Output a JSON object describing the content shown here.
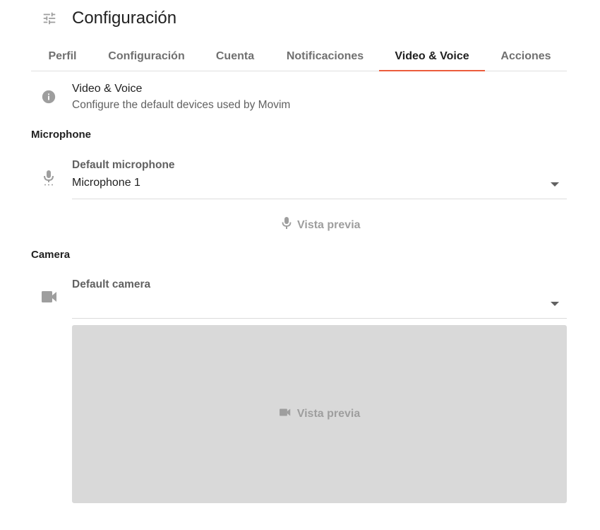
{
  "header": {
    "title": "Configuración",
    "icon": "tune-icon"
  },
  "tabs": [
    {
      "label": "Perfil",
      "active": false
    },
    {
      "label": "Configuración",
      "active": false
    },
    {
      "label": "Cuenta",
      "active": false
    },
    {
      "label": "Notificaciones",
      "active": false
    },
    {
      "label": "Video & Voice",
      "active": true
    },
    {
      "label": "Acciones",
      "active": false
    }
  ],
  "info": {
    "icon": "info-icon",
    "title": "Video & Voice",
    "subtitle": "Configure the default devices used by Movim"
  },
  "microphone": {
    "section_label": "Microphone",
    "field_label": "Default microphone",
    "selected": "Microphone 1",
    "preview_label": "Vista previa",
    "icon": "mic-icon"
  },
  "camera": {
    "section_label": "Camera",
    "field_label": "Default camera",
    "selected": "",
    "preview_label": "Vista previa",
    "icon": "videocam-icon"
  },
  "colors": {
    "accent": "#ec5c3c",
    "preview_bg": "#d9d9d9",
    "muted_text": "#9e9e9e"
  }
}
